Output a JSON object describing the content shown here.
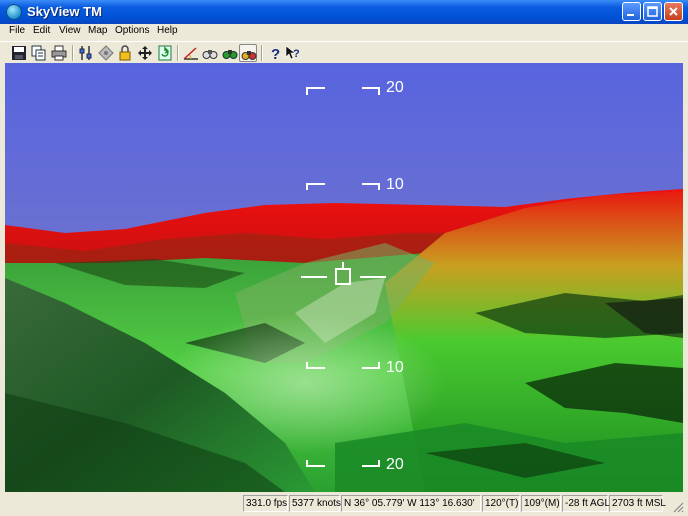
{
  "window": {
    "title": "SkyView TM"
  },
  "menu": [
    "File",
    "Edit",
    "View",
    "Map",
    "Options",
    "Help"
  ],
  "toolbar": {
    "buttons": [
      {
        "name": "save-icon"
      },
      {
        "name": "copy-icon"
      },
      {
        "name": "print-icon"
      },
      {
        "name": "settings-icon"
      },
      {
        "name": "center-icon"
      },
      {
        "name": "lock-icon"
      },
      {
        "name": "move-icon"
      },
      {
        "name": "refresh-icon"
      },
      {
        "name": "angle-icon"
      },
      {
        "name": "binoculars-icon"
      },
      {
        "name": "binoculars-green-icon"
      },
      {
        "name": "binoculars-active-icon"
      },
      {
        "name": "help-icon"
      },
      {
        "name": "context-help-icon"
      }
    ]
  },
  "hud": {
    "pitch_up_20": "20",
    "pitch_up_10": "10",
    "pitch_down_10": "10",
    "pitch_down_20": "20"
  },
  "status": {
    "fps": "331.0 fps",
    "speed": "5377 knots",
    "position": "N  36° 05.779'   W  113° 16.630'",
    "heading_true": "120°(T)",
    "heading_mag": "109°(M)",
    "agl": "-28 ft AGL",
    "msl": "2703 ft MSL"
  },
  "colors": {
    "sky_top": "#5a64e0",
    "sky_horizon": "#8a90c8",
    "terrain_high": "#e01010",
    "terrain_low": "#20b030"
  }
}
